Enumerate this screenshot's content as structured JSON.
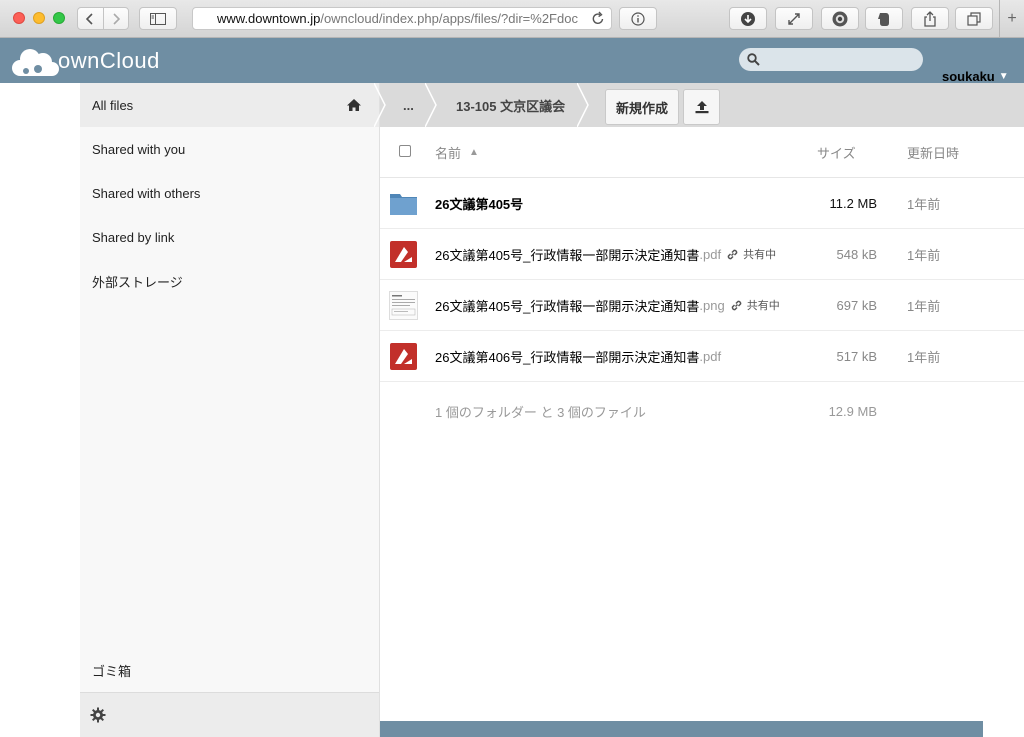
{
  "browser": {
    "url_host": "www.downtown.jp",
    "url_path": "/owncloud/index.php/apps/files/?dir=%2Fdoc"
  },
  "app": {
    "logo_text": "ownCloud",
    "brand_color": "#6f8ea3",
    "search_placeholder": "",
    "username": "soukaku",
    "user_caret": "▼"
  },
  "sidebar": {
    "items": [
      {
        "label": "All files",
        "active": true
      },
      {
        "label": "Shared with you"
      },
      {
        "label": "Shared with others"
      },
      {
        "label": "Shared by link"
      },
      {
        "label": "外部ストレージ"
      }
    ],
    "trash_label": "ゴミ箱",
    "settings_icon": "gear-icon"
  },
  "breadcrumb": {
    "home_icon": "home-icon",
    "ellipsis": "...",
    "current": "13-105 文京区議会"
  },
  "actions": {
    "new_label": "新規作成",
    "upload_icon": "upload-icon"
  },
  "table": {
    "headers": {
      "name": "名前",
      "sort_indicator": "▲",
      "size": "サイズ",
      "modified": "更新日時"
    },
    "rows": [
      {
        "type": "folder",
        "name": "26文議第405号",
        "ext": "",
        "shared": false,
        "share_label": "",
        "size": "11.2 MB",
        "modified": "1年前"
      },
      {
        "type": "pdf",
        "name": "26文議第405号_行政情報一部開示決定通知書",
        "ext": ".pdf",
        "shared": true,
        "share_label": "共有中",
        "size": "548 kB",
        "modified": "1年前"
      },
      {
        "type": "png",
        "name": "26文議第405号_行政情報一部開示決定通知書",
        "ext": ".png",
        "shared": true,
        "share_label": "共有中",
        "size": "697 kB",
        "modified": "1年前"
      },
      {
        "type": "pdf",
        "name": "26文議第406号_行政情報一部開示決定通知書",
        "ext": ".pdf",
        "shared": false,
        "share_label": "",
        "size": "517 kB",
        "modified": "1年前"
      }
    ],
    "summary_text": "1 個のフォルダー と 3 個のファイル",
    "summary_size": "12.9 MB"
  }
}
